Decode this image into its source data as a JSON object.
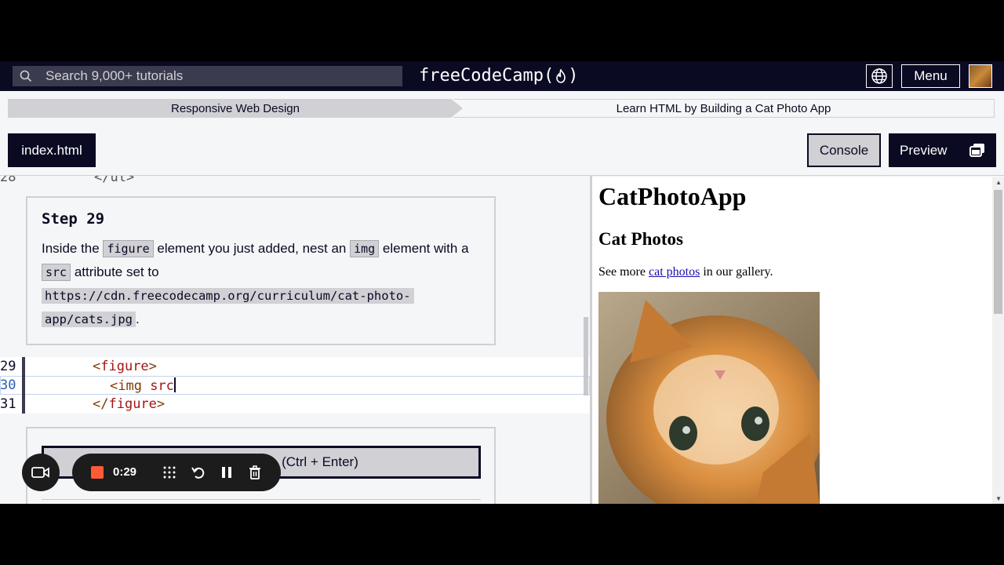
{
  "nav": {
    "search_placeholder": "Search 9,000+ tutorials",
    "logo_text_left": "freeCodeCamp(",
    "logo_text_right": ")",
    "menu_label": "Menu"
  },
  "breadcrumb": {
    "course": "Responsive Web Design",
    "project": "Learn HTML by Building a Cat Photo App"
  },
  "toolbar": {
    "file_tab": "index.html",
    "console_label": "Console",
    "preview_label": "Preview"
  },
  "editor": {
    "top_line": {
      "number": "28",
      "text": "</ul>"
    },
    "step": {
      "title": "Step 29",
      "text_1": "Inside the ",
      "code_1": "figure",
      "text_2": " element you just added, nest an ",
      "code_2": "img",
      "text_3": " element with a ",
      "code_3": "src",
      "text_4": " attribute set to ",
      "url_1": "https://cdn.freecodecamp.org/curriculum/cat-photo-",
      "url_2": "app/cats.jpg",
      "text_5": "."
    },
    "lines": [
      {
        "number": "29",
        "open": "<",
        "tag": "figure",
        "close": ">"
      },
      {
        "number": "30",
        "open": "<img ",
        "attr": "src"
      },
      {
        "number": "31",
        "open": "</",
        "tag": "figure",
        "close": ">"
      }
    ],
    "check_button_label": "(Ctrl + Enter)"
  },
  "preview": {
    "h1": "CatPhotoApp",
    "h2": "Cat Photos",
    "p_before": "See more ",
    "p_link": "cat photos",
    "p_after": " in our gallery."
  },
  "recorder": {
    "time": "0:29",
    "stop_color": "#ff5a36"
  },
  "colors": {
    "nav_bg": "#0a0a23",
    "panel_bg": "#f5f6f7",
    "chip_bg": "#d0d0d5"
  }
}
